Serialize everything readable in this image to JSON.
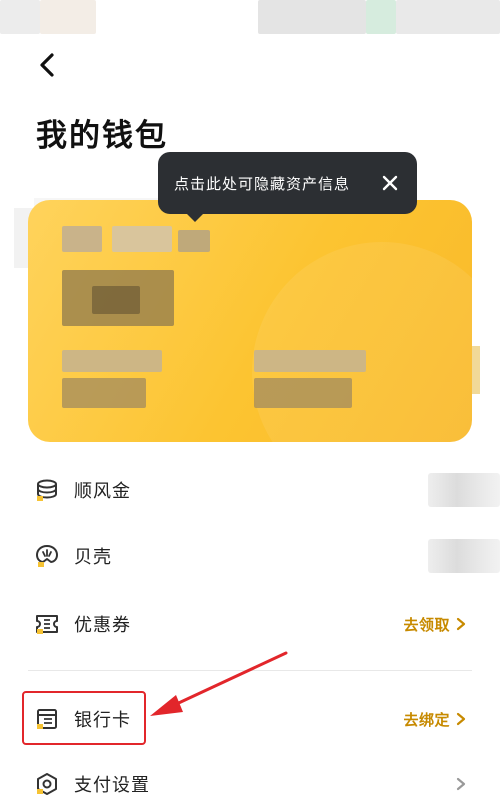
{
  "nav": {
    "back_icon": "chevron-left-icon"
  },
  "page": {
    "title": "我的钱包"
  },
  "tooltip": {
    "text": "点击此处可隐藏资产信息",
    "close_icon": "close-icon"
  },
  "list": {
    "shunfengjin": {
      "label": "顺风金",
      "icon": "coin-stack-icon"
    },
    "beike": {
      "label": "贝壳",
      "icon": "shell-icon"
    },
    "coupon": {
      "label": "优惠券",
      "action": "去领取",
      "icon": "ticket-icon"
    },
    "bankcard": {
      "label": "银行卡",
      "action": "去绑定",
      "icon": "bank-card-icon"
    },
    "payment": {
      "label": "支付设置",
      "icon": "payment-settings-icon"
    }
  },
  "colors": {
    "accent": "#c78a00",
    "card": "#fcc431",
    "annotation": "#e2262b",
    "tooltip_bg": "#2c2f33"
  }
}
